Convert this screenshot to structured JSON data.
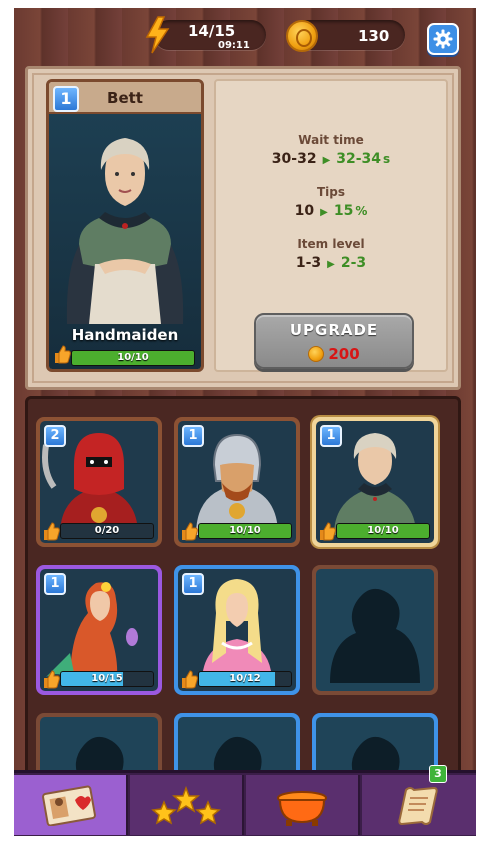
{
  "header": {
    "energy": "14/15",
    "energy_timer": "09:11",
    "coins": "130"
  },
  "selected": {
    "level": "1",
    "name": "Bett",
    "role": "Handmaiden",
    "progress_text": "10/10",
    "progress": 1.0,
    "stats": {
      "wait_label": "Wait time",
      "wait_old": "30-32",
      "wait_new": "32-34",
      "wait_unit": "s",
      "tips_label": "Tips",
      "tips_old": "10",
      "tips_new": "15",
      "tips_unit": "%",
      "item_label": "Item level",
      "item_old": "1-3",
      "item_new": "2-3"
    },
    "upgrade_label": "UPGRADE",
    "upgrade_price": "200"
  },
  "collection": [
    {
      "level": "2",
      "progress_text": "0/20",
      "progress": 0.0,
      "frame": "brown",
      "character": "red-hooded-executioner"
    },
    {
      "level": "1",
      "progress_text": "10/10",
      "progress": 1.0,
      "frame": "brown",
      "character": "armored-knight"
    },
    {
      "level": "1",
      "progress_text": "10/10",
      "progress": 1.0,
      "frame": "gold",
      "character": "handmaiden"
    },
    {
      "level": "1",
      "progress_text": "10/15",
      "progress": 0.67,
      "frame": "purple",
      "character": "mermaid"
    },
    {
      "level": "1",
      "progress_text": "10/12",
      "progress": 0.83,
      "frame": "blue",
      "character": "blonde-princess"
    },
    {
      "frame": "dark",
      "character": "locked-silhouette"
    },
    {
      "frame": "dark",
      "character": "locked-silhouette"
    },
    {
      "frame": "blue",
      "character": "locked-silhouette"
    },
    {
      "frame": "blue",
      "character": "locked-silhouette"
    }
  ],
  "nav": {
    "tabs": [
      "staff-card-icon",
      "stars-icon",
      "cauldron-icon",
      "scroll-icon"
    ],
    "active": 0,
    "scroll_badge": "3"
  },
  "colors": {
    "progress_full": "#4cae2e",
    "progress_partial": "#42b6e8",
    "upgrade_price": "#d71616",
    "stat_new": "#3e8e26"
  }
}
